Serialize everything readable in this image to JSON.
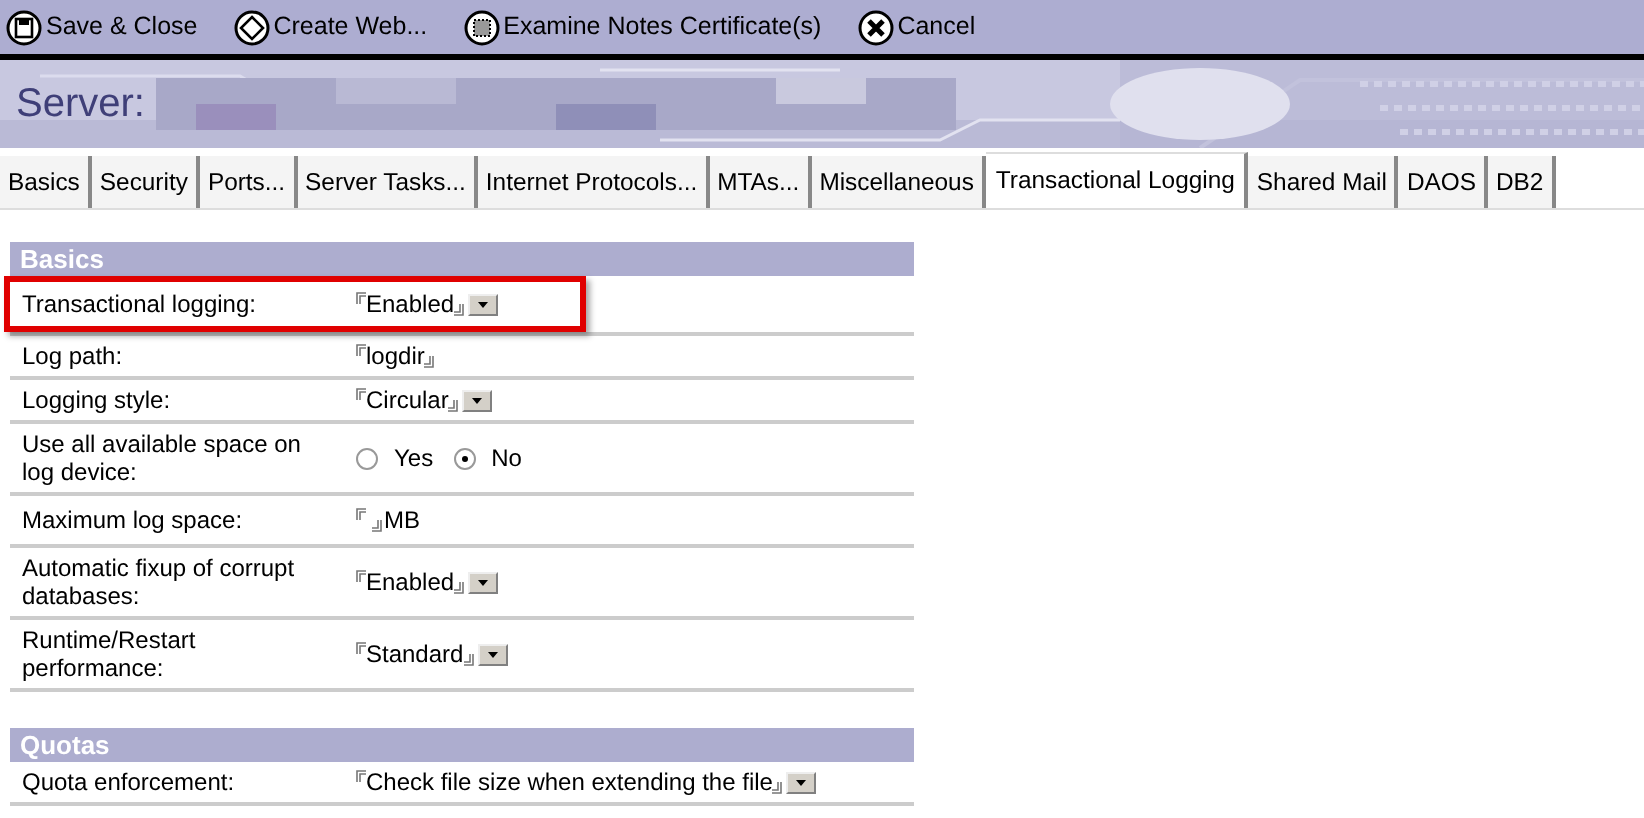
{
  "toolbar": [
    {
      "label": "Save & Close"
    },
    {
      "label": "Create Web..."
    },
    {
      "label": "Examine Notes Certificate(s)"
    },
    {
      "label": "Cancel"
    }
  ],
  "banner": {
    "title": "Server:"
  },
  "tabs": [
    {
      "label": "Basics",
      "selected": false
    },
    {
      "label": "Security",
      "selected": false
    },
    {
      "label": "Ports...",
      "selected": false
    },
    {
      "label": "Server Tasks...",
      "selected": false
    },
    {
      "label": "Internet Protocols...",
      "selected": false
    },
    {
      "label": "MTAs...",
      "selected": false
    },
    {
      "label": "Miscellaneous",
      "selected": false
    },
    {
      "label": "Transactional Logging",
      "selected": true
    },
    {
      "label": "Shared Mail",
      "selected": false
    },
    {
      "label": "DAOS",
      "selected": false
    },
    {
      "label": "DB2",
      "selected": false
    }
  ],
  "sections": [
    {
      "title": "Basics",
      "rows": [
        {
          "label": "Transactional logging:",
          "kind": "dropdown",
          "value": "Enabled",
          "highlighted": true
        },
        {
          "label": "Log path:",
          "kind": "text",
          "value": "logdir",
          "highlighted": false
        },
        {
          "label": "Logging style:",
          "kind": "dropdown",
          "value": "Circular",
          "highlighted": false
        },
        {
          "label": "Use all available space on log device:",
          "kind": "radio",
          "options": [
            {
              "label": "Yes",
              "selected": false
            },
            {
              "label": "No",
              "selected": true
            }
          ],
          "highlighted": false
        },
        {
          "label": "Maximum log space:",
          "kind": "number",
          "unit": "MB",
          "highlighted": false
        },
        {
          "label": "Automatic fixup of corrupt databases:",
          "kind": "dropdown",
          "value": "Enabled",
          "highlighted": false
        },
        {
          "label": "Runtime/Restart performance:",
          "kind": "dropdown",
          "value": "Standard",
          "highlighted": false
        }
      ]
    },
    {
      "title": "Quotas",
      "rows": [
        {
          "label": "Quota enforcement:",
          "kind": "dropdown",
          "value": "Check file size when extending the file",
          "highlighted": false
        }
      ]
    }
  ]
}
